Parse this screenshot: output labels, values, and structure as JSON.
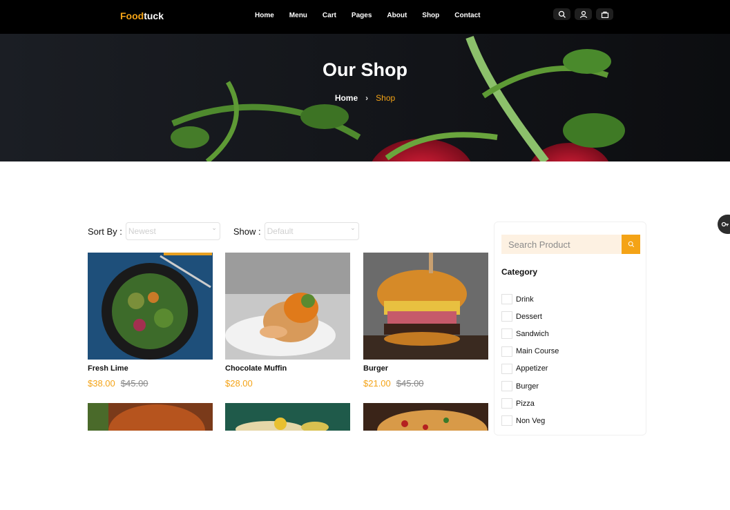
{
  "header": {
    "logo_part1": "Food",
    "logo_part2": "tuck",
    "nav": [
      "Home",
      "Menu",
      "Cart",
      "Pages",
      "About",
      "Shop",
      "Contact"
    ],
    "icons": [
      "search-icon",
      "user-icon",
      "bag-icon"
    ]
  },
  "hero": {
    "title": "Our Shop",
    "breadcrumb_home": "Home",
    "breadcrumb_sep": "›",
    "breadcrumb_current": "Shop"
  },
  "filters": {
    "sort_label": "Sort By :",
    "sort_value": "Newest",
    "show_label": "Show :",
    "show_value": "Default"
  },
  "products": [
    {
      "name": "Fresh Lime",
      "price": "$38.00",
      "old_price": "$45.00"
    },
    {
      "name": "Chocolate Muffin",
      "price": "$28.00",
      "old_price": ""
    },
    {
      "name": "Burger",
      "price": "$21.00",
      "old_price": "$45.00"
    }
  ],
  "sidebar": {
    "search_placeholder": "Search Product",
    "category_title": "Category",
    "categories": [
      "Drink",
      "Dessert",
      "Sandwich",
      "Main Course",
      "Appetizer",
      "Burger",
      "Pizza",
      "Non Veg"
    ]
  },
  "colors": {
    "accent": "#f4a316",
    "header_bg": "#000000"
  }
}
